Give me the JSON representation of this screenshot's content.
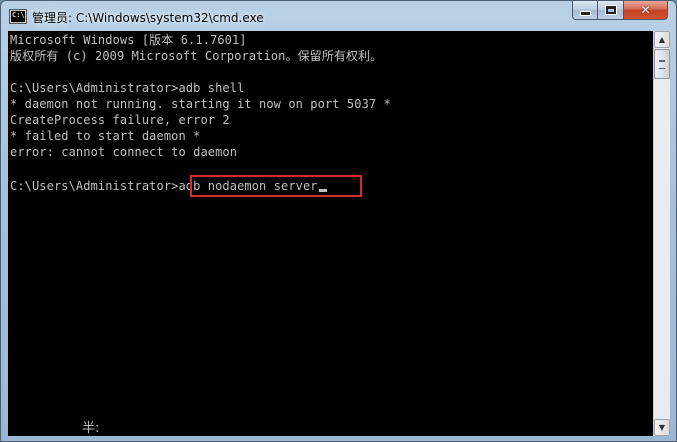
{
  "window": {
    "title": "管理员: C:\\Windows\\system32\\cmd.exe",
    "icon": "cmd-icon"
  },
  "controls": {
    "minimize": "minimize-icon",
    "maximize": "maximize-icon",
    "close_label": "✕"
  },
  "console": {
    "lines": [
      "Microsoft Windows [版本 6.1.7601]",
      "版权所有 (c) 2009 Microsoft Corporation。保留所有权利。",
      "",
      "C:\\Users\\Administrator>adb shell",
      "* daemon not running. starting it now on port 5037 *",
      "CreateProcess failure, error 2",
      "* failed to start daemon *",
      "error: cannot connect to daemon",
      "",
      "C:\\Users\\Administrator>"
    ],
    "current_input": "adb nodaemon server",
    "ime_status": "半:"
  },
  "colors": {
    "console_bg": "#000000",
    "console_fg": "#c0c0c0",
    "highlight": "#d42a2a"
  }
}
